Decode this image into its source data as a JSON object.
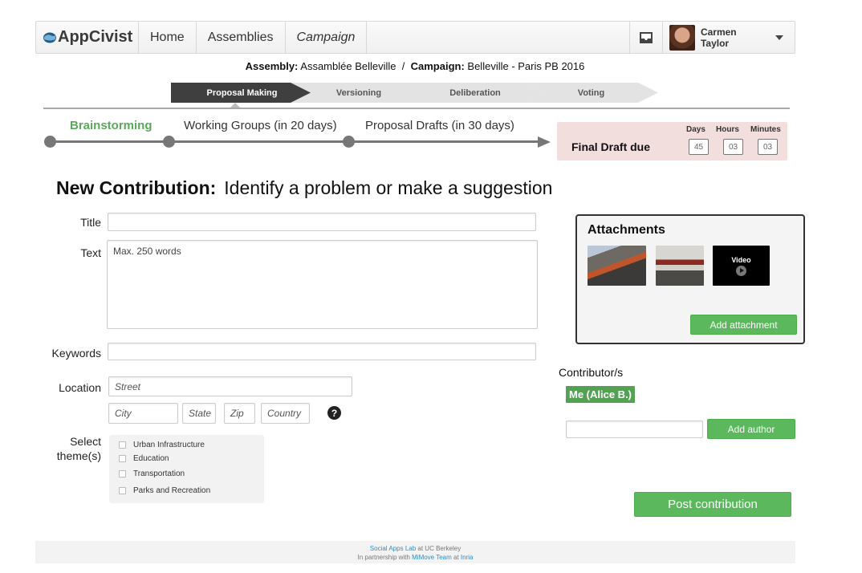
{
  "navbar": {
    "brand": "AppCivist",
    "items": [
      {
        "label": "Home"
      },
      {
        "label": "Assemblies"
      },
      {
        "label": "Campaign"
      }
    ],
    "user_name": "Carmen Taylor"
  },
  "context": {
    "assembly_label": "Assembly:",
    "assembly_value": "Assamblée Belleville",
    "separator": "/",
    "campaign_label": "Campaign:",
    "campaign_value": "Belleville - Paris PB 2016"
  },
  "phases": [
    {
      "label": "Proposal Making",
      "active": true
    },
    {
      "label": "Versioning",
      "active": false
    },
    {
      "label": "Deliberation",
      "active": false
    },
    {
      "label": "Voting",
      "active": false
    }
  ],
  "timeline": {
    "stages": [
      {
        "label": "Brainstorming",
        "current": true
      },
      {
        "label": "Working Groups (in 20 days)",
        "current": false
      },
      {
        "label": "Proposal Drafts (in 30 days)",
        "current": false
      }
    ],
    "deadline_label": "Final Draft due",
    "countdown": {
      "days_label": "Days",
      "days": "45",
      "hours_label": "Hours",
      "hours": "03",
      "minutes_label": "Minutes",
      "minutes": "03"
    }
  },
  "heading": {
    "bold": "New Contribution:",
    "rest": "Identify a problem or make a suggestion"
  },
  "form": {
    "title_label": "Title",
    "title_value": "",
    "text_label": "Text",
    "text_placeholder": "Max. 250 words",
    "keywords_label": "Keywords",
    "keywords_value": "",
    "location_label": "Location",
    "street_placeholder": "Street",
    "city_placeholder": "City",
    "state_placeholder": "State",
    "zip_placeholder": "Zip",
    "country_placeholder": "Country",
    "themes_label_line1": "Select",
    "themes_label_line2": "theme(s)",
    "themes": [
      {
        "label": "Urban Infrastructure",
        "checked": false
      },
      {
        "label": "Education",
        "checked": false
      },
      {
        "label": "Transportation",
        "checked": false
      },
      {
        "label": "Parks and Recreation",
        "checked": false
      }
    ]
  },
  "attachments": {
    "title": "Attachments",
    "video_label": "Video",
    "add_label": "Add attachment"
  },
  "contributors": {
    "label": "Contributor/s",
    "current": "Me (Alice B.)",
    "author_input_value": "",
    "add_label": "Add author"
  },
  "post_label": "Post contribution",
  "footer": {
    "line1_link": "Social Apps Lab",
    "line1_rest": " at UC Berkeley",
    "line2_prefix": "In partnership with ",
    "line2_link1": "MiMove Team",
    "line2_mid": " at ",
    "line2_link2": "Inria"
  },
  "colors": {
    "accent_green": "#5cb85c",
    "active_phase": "#3f3f3f",
    "deadline_bg": "#f3dede",
    "current_stage": "#5aa85a"
  }
}
